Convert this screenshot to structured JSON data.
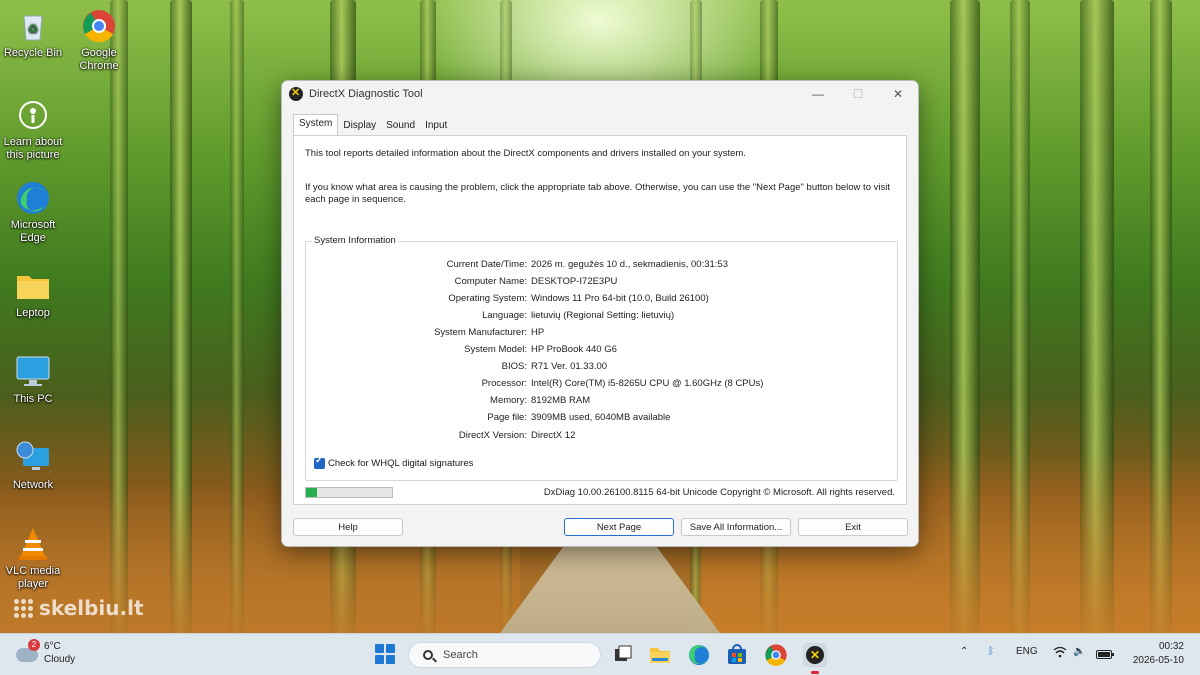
{
  "desktop": {
    "icons": [
      {
        "label": "Recycle Bin",
        "icon": "recycle-bin-icon"
      },
      {
        "label": "Google Chrome",
        "icon": "chrome-icon"
      },
      {
        "label": "Learn about this picture",
        "icon": "learn-about-picture-icon"
      },
      {
        "label": "Microsoft Edge",
        "icon": "edge-icon"
      },
      {
        "label": "Leptop",
        "icon": "folder-icon"
      },
      {
        "label": "This PC",
        "icon": "this-pc-icon"
      },
      {
        "label": "Network",
        "icon": "network-icon"
      },
      {
        "label": "VLC media player",
        "icon": "vlc-icon"
      }
    ],
    "watermark": "skelbiu.lt"
  },
  "window": {
    "title": "DirectX Diagnostic Tool",
    "tabs": [
      "System",
      "Display",
      "Sound",
      "Input"
    ],
    "active_tab": "System",
    "intro_line1": "This tool reports detailed information about the DirectX components and drivers installed on your system.",
    "intro_line2": "If you know what area is causing the problem, click the appropriate tab above.  Otherwise, you can use the \"Next Page\" button below to visit each page in sequence.",
    "group_title": "System Information",
    "info": [
      {
        "key": "Current Date/Time:",
        "value": "2026 m. gegužės 10 d., sekmadienis, 00:31:53"
      },
      {
        "key": "Computer Name:",
        "value": "DESKTOP-I72E3PU"
      },
      {
        "key": "Operating System:",
        "value": "Windows 11 Pro 64-bit (10.0, Build 26100)"
      },
      {
        "key": "Language:",
        "value": "lietuvių (Regional Setting: lietuvių)"
      },
      {
        "key": "System Manufacturer:",
        "value": "HP"
      },
      {
        "key": "System Model:",
        "value": "HP ProBook 440 G6"
      },
      {
        "key": "BIOS:",
        "value": "R71 Ver. 01.33.00"
      },
      {
        "key": "Processor:",
        "value": "Intel(R) Core(TM) i5-8265U CPU @ 1.60GHz (8 CPUs)"
      },
      {
        "key": "Memory:",
        "value": "8192MB RAM"
      },
      {
        "key": "Page file:",
        "value": "3909MB used, 6040MB available"
      },
      {
        "key": "DirectX Version:",
        "value": "DirectX 12"
      }
    ],
    "whql_label": "Check for WHQL digital signatures",
    "whql_checked": true,
    "progress_fraction": 0.13,
    "progress_color": "#26b050",
    "copyright": "DxDiag 10.00.26100.8115 64-bit Unicode  Copyright © Microsoft. All rights reserved.",
    "buttons": {
      "help": "Help",
      "next_page": "Next Page",
      "save_all": "Save All Information...",
      "exit": "Exit"
    }
  },
  "taskbar": {
    "weather_temp": "6°C",
    "weather_desc": "Cloudy",
    "weather_badge": "2",
    "search_label": "Search",
    "apps": [
      "task-view-icon",
      "file-explorer-icon",
      "edge-icon",
      "store-icon",
      "chrome-icon",
      "dxdiag-icon"
    ],
    "language": "ENG",
    "time": "00:32",
    "date": "2026-05-10"
  }
}
